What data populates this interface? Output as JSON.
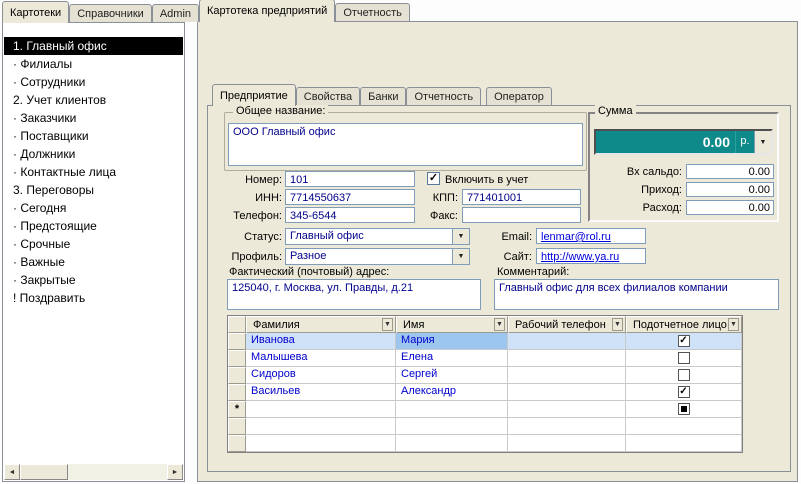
{
  "icons": {
    "dropdown": "▼",
    "scroll_left": "◄",
    "scroll_right": "►",
    "check": "✓"
  },
  "colors": {
    "accent_teal": "#0e8a8a",
    "link_blue": "#0000dd",
    "grid_text_blue": "#0000cd",
    "selection_black": "#000000",
    "row_highlight": "#cfe2f8"
  },
  "left_tabs": [
    {
      "label": "Картотеки",
      "active": true
    },
    {
      "label": "Справочники",
      "active": false
    },
    {
      "label": "Admin",
      "active": false
    }
  ],
  "tree": {
    "items": [
      {
        "label": "1. Главный офис",
        "selected": true
      },
      {
        "label": "· Филиалы",
        "selected": false
      },
      {
        "label": "· Сотрудники",
        "selected": false
      },
      {
        "label": "2. Учет клиентов",
        "selected": false
      },
      {
        "label": "· Заказчики",
        "selected": false
      },
      {
        "label": "· Поставщики",
        "selected": false
      },
      {
        "label": "· Должники",
        "selected": false
      },
      {
        "label": "· Контактные лица",
        "selected": false
      },
      {
        "label": "3. Переговоры",
        "selected": false
      },
      {
        "label": "· Сегодня",
        "selected": false
      },
      {
        "label": "· Предстоящие",
        "selected": false
      },
      {
        "label": "· Срочные",
        "selected": false
      },
      {
        "label": "· Важные",
        "selected": false
      },
      {
        "label": "· Закрытые",
        "selected": false
      },
      {
        "label": "! Поздравить",
        "selected": false
      }
    ]
  },
  "main_tabs": [
    {
      "label": "Картотека предприятий",
      "active": true
    },
    {
      "label": "Отчетность",
      "active": false
    }
  ],
  "inner_tabs": [
    {
      "label": "Предприятие",
      "active": true
    },
    {
      "label": "Свойства",
      "active": false
    },
    {
      "label": "Банки",
      "active": false
    },
    {
      "label": "Отчетность",
      "active": false
    },
    {
      "label": "Оператор",
      "active": false
    }
  ],
  "form": {
    "common_name_label": "Общее название:",
    "common_name": "ООО Главный офис",
    "number_label": "Номер:",
    "number": "101",
    "include_label": "Включить в учет",
    "include_checked": true,
    "inn_label": "ИНН:",
    "inn": "7714550637",
    "kpp_label": "КПП:",
    "kpp": "771401001",
    "phone_label": "Телефон:",
    "phone": "345-6544",
    "fax_label": "Факс:",
    "fax": "",
    "status_label": "Статус:",
    "status": "Главный офис",
    "email_label": "Email:",
    "email": "lenmar@rol.ru",
    "profile_label": "Профиль:",
    "profile": "Разное",
    "site_label": "Сайт:",
    "site": "http://www.ya.ru",
    "address_label": "Фактический (почтовый) адрес:",
    "address": "125040, г. Москва, ул. Правды, д.21",
    "comment_label": "Комментарий:",
    "comment": "Главный офис для всех филиалов компании"
  },
  "summa": {
    "label": "Сумма",
    "total": "0.00",
    "currency": "р.",
    "rows": [
      {
        "label": "Вх сальдо:",
        "value": "0.00"
      },
      {
        "label": "Приход:",
        "value": "0.00"
      },
      {
        "label": "Расход:",
        "value": "0.00"
      }
    ]
  },
  "grid": {
    "columns": [
      "Фамилия",
      "Имя",
      "Рабочий телефон",
      "Подотчетное лицо"
    ],
    "new_row_marker": "*",
    "rows": [
      {
        "surname": "Иванова",
        "name": "Мария",
        "phone": "",
        "accountable": true,
        "selected": true
      },
      {
        "surname": "Малышева",
        "name": "Елена",
        "phone": "",
        "accountable": false,
        "selected": false
      },
      {
        "surname": "Сидоров",
        "name": "Сергей",
        "phone": "",
        "accountable": false,
        "selected": false
      },
      {
        "surname": "Васильев",
        "name": "Александр",
        "phone": "",
        "accountable": true,
        "selected": false
      },
      {
        "surname": "",
        "name": "",
        "phone": "",
        "accountable": null,
        "is_new": true
      }
    ]
  }
}
